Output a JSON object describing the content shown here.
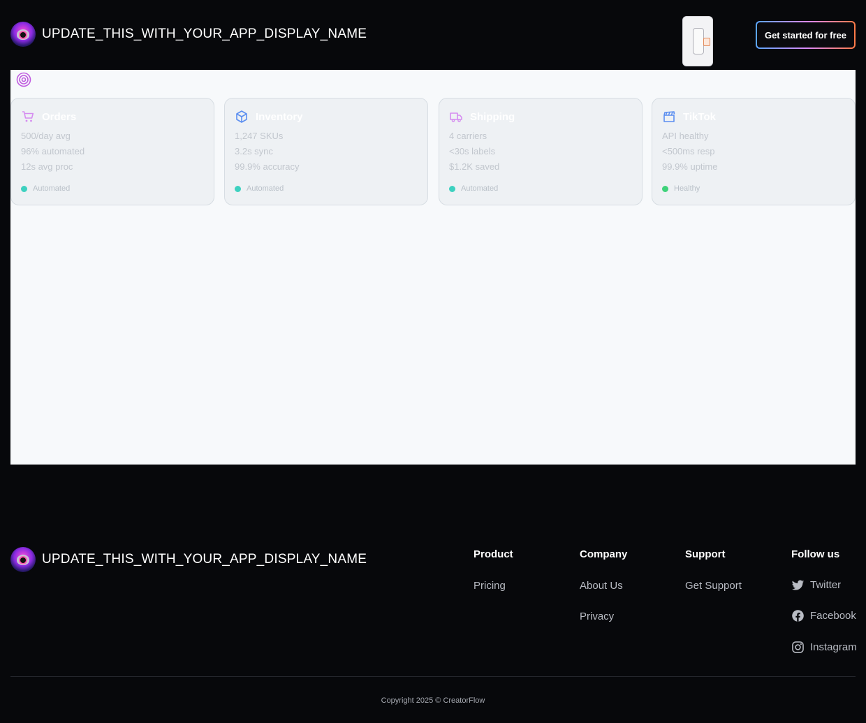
{
  "header": {
    "app_name": "UPDATE_THIS_WITH_YOUR_APP_DISPLAY_NAME",
    "cta_label": "Get started for free"
  },
  "cards": [
    {
      "title": "Orders",
      "icon": "shopping-cart-icon",
      "stats": [
        "500/day avg",
        "96% automated",
        "12s avg proc"
      ],
      "status": "Automated",
      "status_color": "#3dd1c0"
    },
    {
      "title": "Inventory",
      "icon": "box-icon",
      "stats": [
        "1,247 SKUs",
        "3.2s sync",
        "99.9% accuracy"
      ],
      "status": "Automated",
      "status_color": "#3dd1c0"
    },
    {
      "title": "Shipping",
      "icon": "truck-icon",
      "stats": [
        "4 carriers",
        "<30s labels",
        "$1.2K saved"
      ],
      "status": "Automated",
      "status_color": "#3dd1c0"
    },
    {
      "title": "TikTok",
      "icon": "clapperboard-icon",
      "stats": [
        "API healthy",
        "<500ms resp",
        "99.9% uptime"
      ],
      "status": "Healthy",
      "status_color": "#3ed27a"
    }
  ],
  "footer": {
    "app_name": "UPDATE_THIS_WITH_YOUR_APP_DISPLAY_NAME",
    "columns": [
      {
        "title": "Product",
        "links": [
          "Pricing"
        ]
      },
      {
        "title": "Company",
        "links": [
          "About Us",
          "Privacy"
        ]
      },
      {
        "title": "Support",
        "links": [
          "Get Support"
        ]
      },
      {
        "title": "Follow us",
        "links": [
          "Twitter",
          "Facebook",
          "Instagram"
        ]
      }
    ],
    "copyright": "Copyright 2025 © CreatorFlow"
  }
}
